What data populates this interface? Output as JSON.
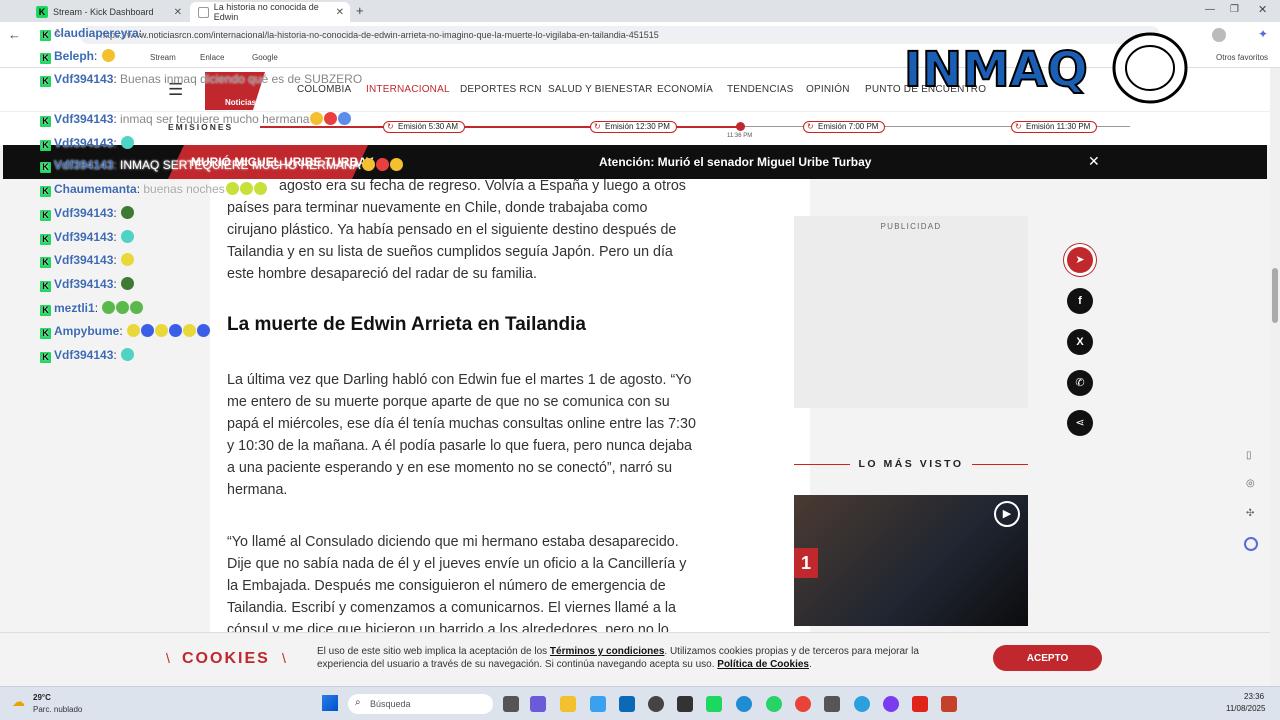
{
  "browser": {
    "tabs": [
      {
        "title": "Stream - Kick Dashboard"
      },
      {
        "title": "La historia no conocida de Edwin"
      }
    ],
    "url": "https://www.noticiasrcn.com/internacional/la-historia-no-conocida-de-edwin-arrieta-no-imagino-que-la-muerte-lo-vigilaba-en-tailandia-451515",
    "bookmarks": [
      "Stream",
      "Enlace",
      "Google"
    ],
    "other_bookmarks": "Otros favoritos"
  },
  "site": {
    "logo_text": "Noticias",
    "nav": [
      "COLOMBIA",
      "INTERNACIONAL",
      "DEPORTES RCN",
      "SALUD Y BIENESTAR",
      "ECONOMÍA",
      "TENDENCIAS",
      "OPINIÓN",
      "PUNTO DE ENCUENTRO"
    ],
    "emisiones_label": "EMISIONES",
    "emisiones": [
      "Emisión 5:30 AM",
      "Emisión 12:30 PM",
      "Emisión 7:00 PM",
      "Emisión 11:30 PM"
    ],
    "current_time": "11:36 PM",
    "alert": "Atención: Murió el senador Miguel Uribe Turbay",
    "alert_left": "MURIÓ MIGUEL URIBE TURBAY"
  },
  "article": {
    "p1": "agosto era su fecha de regreso. Volvía a España y luego a otros países para terminar nuevamente en Chile, donde trabajaba como cirujano plástico. Ya había pensado en el siguiente destino después de Tailandia y en su lista de sueños cumplidos seguía Japón. Pero un día este hombre desapareció del radar de su familia.",
    "heading": "La muerte de Edwin Arrieta en Tailandia",
    "p2": "La última vez que Darling habló con Edwin fue el martes 1 de agosto. “Yo me entero de su muerte porque aparte de que no se comunica con su papá el miércoles, ese día él tenía muchas consultas online entre las 7:30 y 10:30 de la mañana. A él podía pasarle lo que fuera, pero nunca dejaba a una paciente esperando y en ese momento no se conectó”, narró su hermana.",
    "p3": "“Yo llamé al Consulado diciendo que mi hermano estaba desaparecido. Dije que no sabía nada de él y el jueves envíe un oficio a la Cancillería y la Embajada. Después me consiguieron el número de emergencia de Tailandia. Escribí y comenzamos a comunicarnos. El viernes llamé a la cónsul y me dice que hicieron un barrido a los alrededores, pero no lo"
  },
  "sidebar": {
    "publicidad": "PUBLICIDAD",
    "mas_visto": "LO MÁS VISTO",
    "rank": "1"
  },
  "cookies": {
    "title": "COOKIES",
    "text_a": "El uso de este sitio web implica la aceptación de los ",
    "terms": "Términos y condiciones",
    "text_b": ". Utilizamos cookies propias y de terceros para mejorar la experiencia del usuario a través de su navegación. Si continúa navegando acepta su uso. ",
    "policy": "Política de Cookies",
    "text_c": ".",
    "accept": "ACEPTO"
  },
  "taskbar": {
    "temp": "29°C",
    "weather": "Parc. nublado",
    "search": "Búsqueda",
    "time": "23:36",
    "date": "11/08/2025"
  },
  "chat": [
    {
      "user": "claudiapereyra",
      "msg": ""
    },
    {
      "user": "Beleph",
      "msg": ""
    },
    {
      "user": "Vdf394143",
      "msg": "Buenas inmaq diciendo qué es de SUBZERO"
    },
    {
      "user": "Vdf394143",
      "msg": "inmaq ser tequiere mucho hermana"
    },
    {
      "user": "Vdf394143",
      "msg": ""
    },
    {
      "user": "Vdf394143",
      "msg": "INMAQ SERTEQUIERE MUCHO HERMANA"
    },
    {
      "user": "Chaumemanta",
      "msg": "buenas noches"
    },
    {
      "user": "Vdf394143",
      "msg": ""
    },
    {
      "user": "Vdf394143",
      "msg": ""
    },
    {
      "user": "Vdf394143",
      "msg": ""
    },
    {
      "user": "Vdf394143",
      "msg": ""
    },
    {
      "user": "meztli1",
      "msg": ""
    },
    {
      "user": "Ampybume",
      "msg": ""
    },
    {
      "user": "Vdf394143",
      "msg": ""
    }
  ],
  "overlay_logo": "INMAQ",
  "colors": {
    "brand_red": "#c0282d",
    "chat_user": "#3d6ab3",
    "kick_green": "#1ed760"
  }
}
